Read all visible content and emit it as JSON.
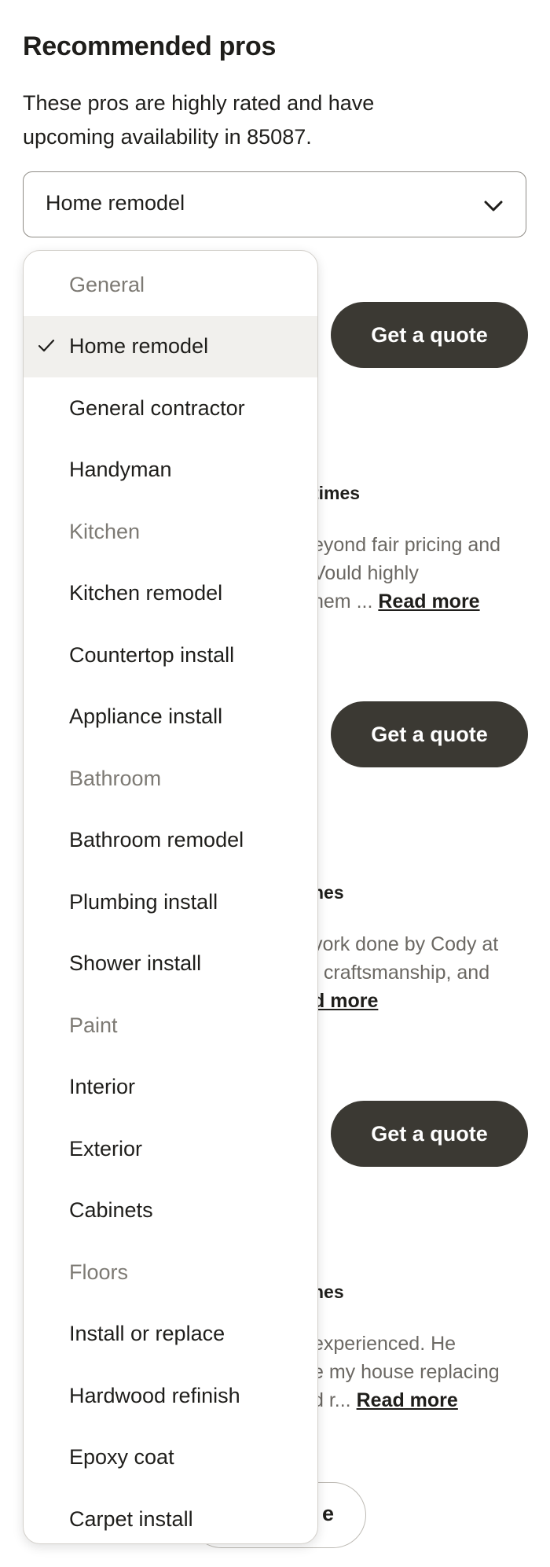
{
  "header": {
    "title": "Recommended pros",
    "subtitle": "These pros are highly rated and have upcoming availability in 85087."
  },
  "select": {
    "value": "Home remodel",
    "icon": "chevron-down-icon"
  },
  "dropdown": {
    "items": [
      {
        "label": "General",
        "type": "group"
      },
      {
        "label": "Home remodel",
        "type": "option",
        "selected": true
      },
      {
        "label": "General contractor",
        "type": "option"
      },
      {
        "label": "Handyman",
        "type": "option"
      },
      {
        "label": "Kitchen",
        "type": "group"
      },
      {
        "label": "Kitchen remodel",
        "type": "option"
      },
      {
        "label": "Countertop install",
        "type": "option"
      },
      {
        "label": "Appliance install",
        "type": "option"
      },
      {
        "label": "Bathroom",
        "type": "group"
      },
      {
        "label": "Bathroom remodel",
        "type": "option"
      },
      {
        "label": "Plumbing install",
        "type": "option"
      },
      {
        "label": "Shower install",
        "type": "option"
      },
      {
        "label": "Paint",
        "type": "group"
      },
      {
        "label": "Interior",
        "type": "option"
      },
      {
        "label": "Exterior",
        "type": "option"
      },
      {
        "label": "Cabinets",
        "type": "option"
      },
      {
        "label": "Floors",
        "type": "group"
      },
      {
        "label": "Install or replace",
        "type": "option"
      },
      {
        "label": "Hardwood refinish",
        "type": "option"
      },
      {
        "label": "Epoxy coat",
        "type": "option"
      },
      {
        "label": "Carpet install",
        "type": "option"
      }
    ]
  },
  "cards": [
    {
      "quote_label": "Get a quote",
      "hires_fragment": "times",
      "review_line1": "eyond fair pricing and",
      "review_line2": "Vould highly",
      "review_line3": "hem ...",
      "read_more": "Read more"
    },
    {
      "quote_label": "Get a quote",
      "hires_fragment": "nes",
      "review_line1": "vork done by Cody at",
      "review_line2": ", craftsmanship, and",
      "read_more": "d more"
    },
    {
      "quote_label": "Get a quote",
      "hires_fragment": "nes",
      "review_line1": "experienced. He",
      "review_line2": "e my house replacing",
      "review_line3": "d r...",
      "read_more": "Read more"
    }
  ],
  "see_more": {
    "label_fragment": "e"
  },
  "colors": {
    "button_dark": "#3b3933",
    "selected_bg": "#f1f0ed",
    "group_text": "#7d7a74"
  }
}
